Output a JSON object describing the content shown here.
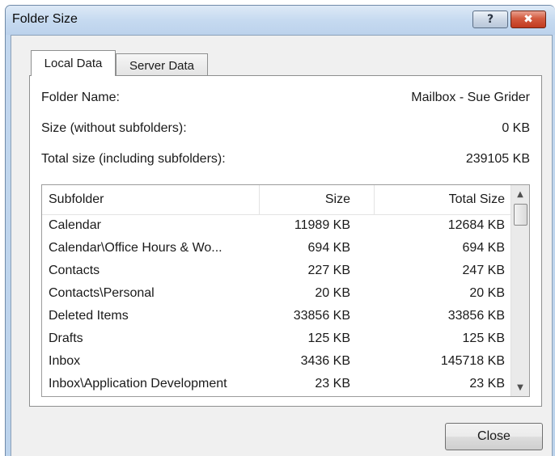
{
  "window": {
    "title": "Folder Size",
    "help_glyph": "?",
    "close_glyph": "✖"
  },
  "tabs": [
    {
      "label": "Local Data",
      "active": true
    },
    {
      "label": "Server Data",
      "active": false
    }
  ],
  "info": {
    "folder_name_label": "Folder Name:",
    "folder_name_value": "Mailbox - Sue Grider",
    "size_label": "Size (without subfolders):",
    "size_value": "0 KB",
    "total_label": "Total size (including subfolders):",
    "total_value": "239105 KB"
  },
  "list": {
    "columns": [
      "Subfolder",
      "Size",
      "Total Size"
    ],
    "rows": [
      {
        "subfolder": "Calendar",
        "size": "11989 KB",
        "total": "12684 KB"
      },
      {
        "subfolder": "Calendar\\Office Hours & Wo...",
        "size": "694 KB",
        "total": "694 KB"
      },
      {
        "subfolder": "Contacts",
        "size": "227 KB",
        "total": "247 KB"
      },
      {
        "subfolder": "Contacts\\Personal",
        "size": "20 KB",
        "total": "20 KB"
      },
      {
        "subfolder": "Deleted Items",
        "size": "33856 KB",
        "total": "33856 KB"
      },
      {
        "subfolder": "Drafts",
        "size": "125 KB",
        "total": "125 KB"
      },
      {
        "subfolder": "Inbox",
        "size": "3436 KB",
        "total": "145718 KB"
      },
      {
        "subfolder": "Inbox\\Application Development",
        "size": "23 KB",
        "total": "23 KB"
      }
    ]
  },
  "scrollbar": {
    "up_glyph": "▲",
    "down_glyph": "▼"
  },
  "buttons": {
    "close_label": "Close"
  },
  "colors": {
    "titlebar": "#c6daf0",
    "close_button_red": "#c13a1e",
    "dialog_bg": "#f0f0f0"
  }
}
